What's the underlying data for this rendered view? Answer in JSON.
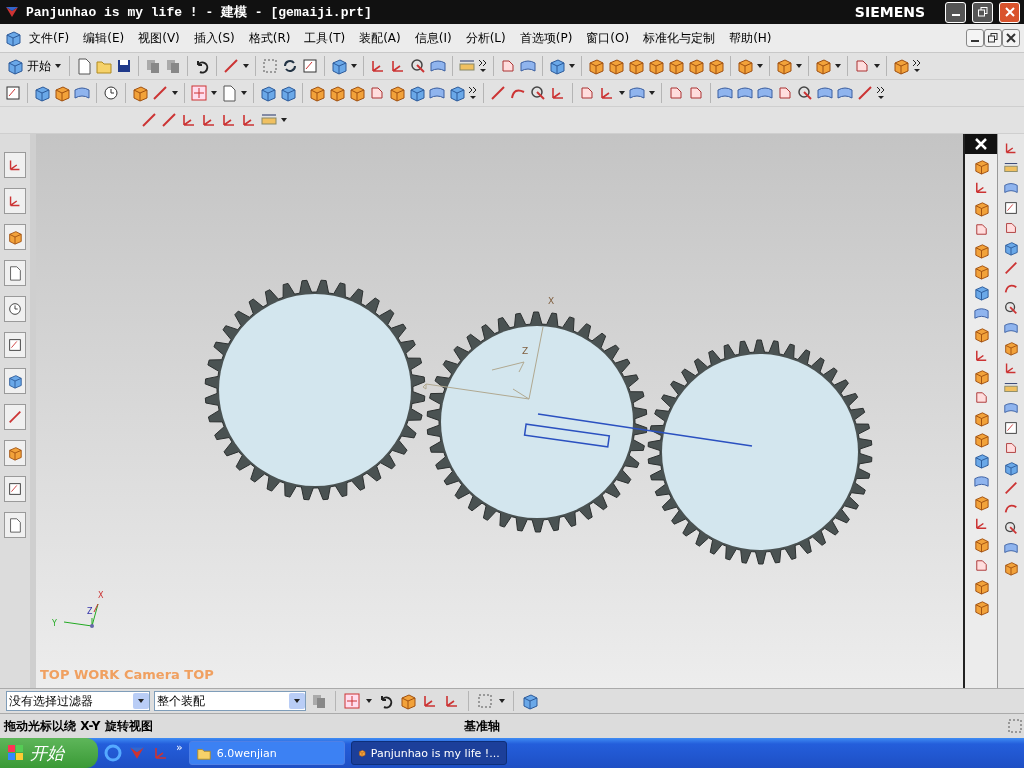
{
  "window": {
    "title": "Panjunhao is my life ! - 建模 - [gemaiji.prt]",
    "brand": "SIEMENS"
  },
  "menu": [
    {
      "label": "文件(F)"
    },
    {
      "label": "编辑(E)"
    },
    {
      "label": "视图(V)"
    },
    {
      "label": "插入(S)"
    },
    {
      "label": "格式(R)"
    },
    {
      "label": "工具(T)"
    },
    {
      "label": "装配(A)"
    },
    {
      "label": "信息(I)"
    },
    {
      "label": "分析(L)"
    },
    {
      "label": "首选项(P)"
    },
    {
      "label": "窗口(O)"
    },
    {
      "label": "标准化与定制"
    },
    {
      "label": "帮助(H)"
    }
  ],
  "start_menu": {
    "label": "开始"
  },
  "viewport": {
    "view_label": "TOP WORK Camera TOP",
    "csys_labels": [
      "X",
      "Z"
    ],
    "triad_labels": [
      "X",
      "Y",
      "Z"
    ]
  },
  "selection_bar": {
    "filter": "没有选择过滤器",
    "scope": "整个装配"
  },
  "status_bar": {
    "message": "拖动光标以绕 X-Y 旋转视图",
    "selection": "基准轴"
  },
  "taskbar": {
    "start": "开始",
    "overflow": "»",
    "tasks": [
      {
        "label": "6.0wenjian",
        "selected": false
      },
      {
        "label": "Panjunhao is my life !...",
        "selected": true
      }
    ]
  }
}
